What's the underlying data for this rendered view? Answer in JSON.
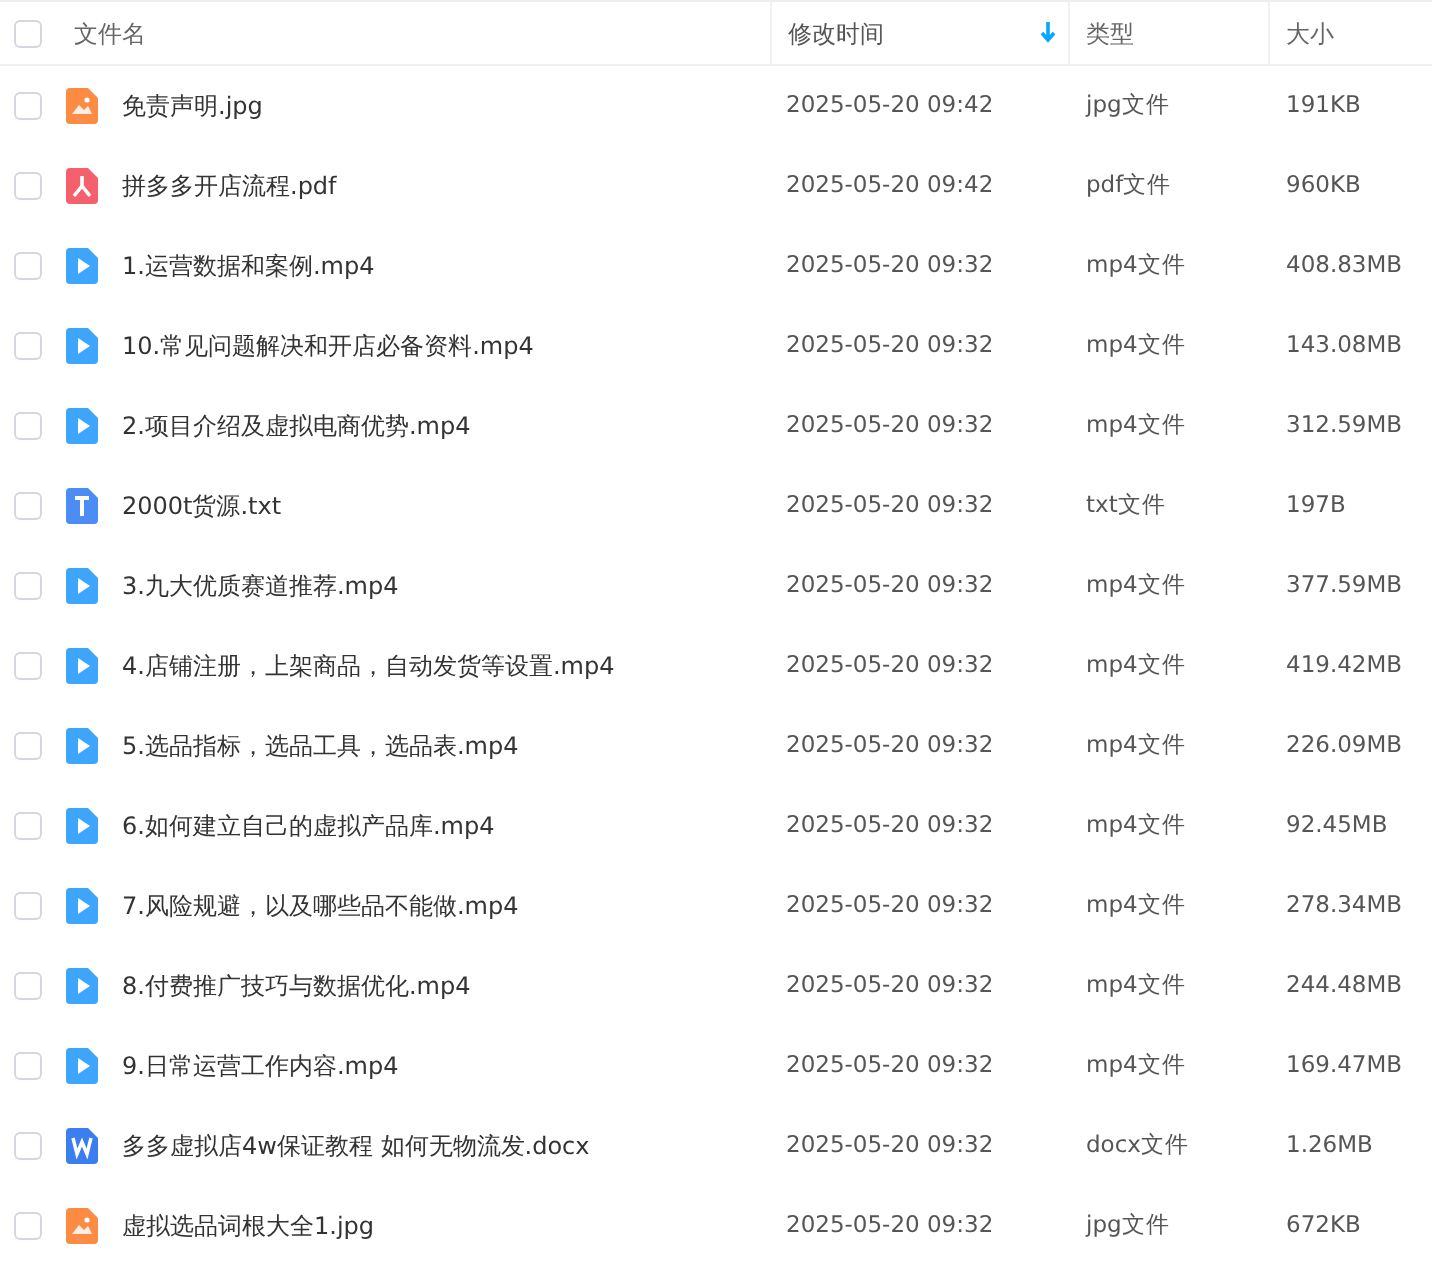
{
  "select_all": {
    "checked": false
  },
  "columns": [
    {
      "label": "文件名",
      "sorted": false
    },
    {
      "label": "修改时间",
      "sorted": true
    },
    {
      "label": "类型",
      "sorted": false
    },
    {
      "label": "大小",
      "sorted": false
    }
  ],
  "rows": [
    {
      "kind": "image",
      "name": "免责声明.jpg",
      "modified": "2025-05-20 09:42",
      "type": "jpg文件",
      "size": "191KB",
      "selected": false
    },
    {
      "kind": "pdf",
      "name": "拼多多开店流程.pdf",
      "modified": "2025-05-20 09:42",
      "type": "pdf文件",
      "size": "960KB",
      "selected": false
    },
    {
      "kind": "video",
      "name": "1.运营数据和案例.mp4",
      "modified": "2025-05-20 09:32",
      "type": "mp4文件",
      "size": "408.83MB",
      "selected": false
    },
    {
      "kind": "video",
      "name": "10.常见问题解决和开店必备资料.mp4",
      "modified": "2025-05-20 09:32",
      "type": "mp4文件",
      "size": "143.08MB",
      "selected": false
    },
    {
      "kind": "video",
      "name": "2.项目介绍及虚拟电商优势.mp4",
      "modified": "2025-05-20 09:32",
      "type": "mp4文件",
      "size": "312.59MB",
      "selected": false
    },
    {
      "kind": "text",
      "name": "2000t货源.txt",
      "modified": "2025-05-20 09:32",
      "type": "txt文件",
      "size": "197B",
      "selected": false
    },
    {
      "kind": "video",
      "name": "3.九大优质赛道推荐.mp4",
      "modified": "2025-05-20 09:32",
      "type": "mp4文件",
      "size": "377.59MB",
      "selected": false
    },
    {
      "kind": "video",
      "name": "4.店铺注册，上架商品，自动发货等设置.mp4",
      "modified": "2025-05-20 09:32",
      "type": "mp4文件",
      "size": "419.42MB",
      "selected": false
    },
    {
      "kind": "video",
      "name": "5.选品指标，选品工具，选品表.mp4",
      "modified": "2025-05-20 09:32",
      "type": "mp4文件",
      "size": "226.09MB",
      "selected": false
    },
    {
      "kind": "video",
      "name": "6.如何建立自己的虚拟产品库.mp4",
      "modified": "2025-05-20 09:32",
      "type": "mp4文件",
      "size": "92.45MB",
      "selected": false
    },
    {
      "kind": "video",
      "name": "7.风险规避，以及哪些品不能做.mp4",
      "modified": "2025-05-20 09:32",
      "type": "mp4文件",
      "size": "278.34MB",
      "selected": false
    },
    {
      "kind": "video",
      "name": "8.付费推广技巧与数据优化.mp4",
      "modified": "2025-05-20 09:32",
      "type": "mp4文件",
      "size": "244.48MB",
      "selected": false
    },
    {
      "kind": "video",
      "name": "9.日常运营工作内容.mp4",
      "modified": "2025-05-20 09:32",
      "type": "mp4文件",
      "size": "169.47MB",
      "selected": false
    },
    {
      "kind": "word",
      "name": "多多虚拟店4w保证教程 如何无物流发.docx",
      "modified": "2025-05-20 09:32",
      "type": "docx文件",
      "size": "1.26MB",
      "selected": false
    },
    {
      "kind": "image",
      "name": "虚拟选品词根大全1.jpg",
      "modified": "2025-05-20 09:32",
      "type": "jpg文件",
      "size": "672KB",
      "selected": false
    }
  ]
}
